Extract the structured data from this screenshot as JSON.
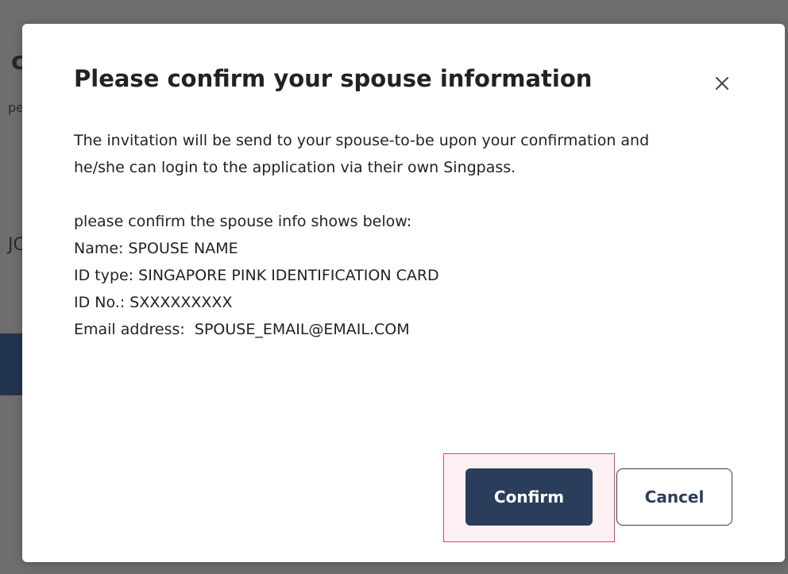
{
  "background": {
    "fragment_1": "c",
    "fragment_2": "pe",
    "fragment_3": "JC"
  },
  "modal": {
    "title": "Please confirm your spouse information",
    "close_icon": "close-icon",
    "intro": "The invitation will be send to your spouse-to-be upon your confirmation and he/she can login to the application via their own Singpass.",
    "details": {
      "lead": "please confirm the spouse info shows below:",
      "name": "Name: SPOUSE NAME",
      "id_type": "ID type: SINGAPORE PINK IDENTIFICATION CARD",
      "id_no": "ID No.: SXXXXXXXXX",
      "email": "Email address:  SPOUSE_EMAIL@EMAIL.COM"
    },
    "buttons": {
      "confirm_label": "Confirm",
      "cancel_label": "Cancel"
    }
  },
  "colors": {
    "primary": "#2a3d5b",
    "highlight_border": "#e0456a",
    "backdrop": "#6e6e6e"
  }
}
